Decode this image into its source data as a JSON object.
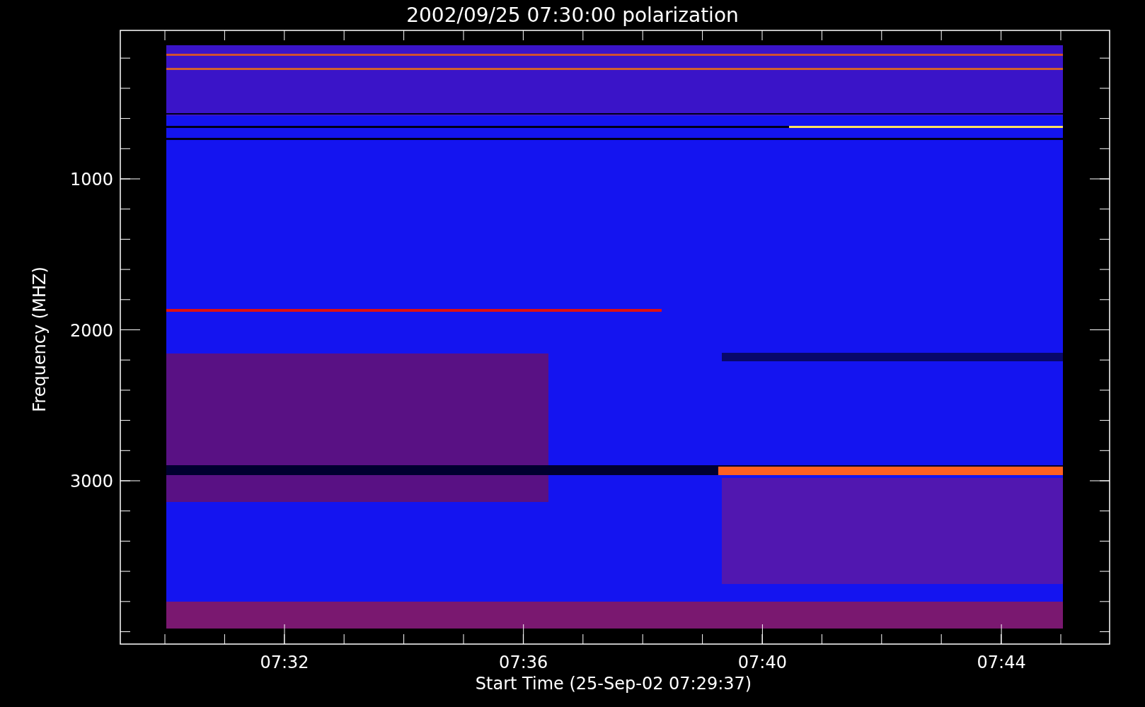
{
  "title": "2002/09/25 07:30:00 polarization",
  "y_axis": {
    "label": "Frequency (MHZ)",
    "ticks": [
      "1000",
      "2000",
      "3000"
    ]
  },
  "x_axis": {
    "label": "Start Time (25-Sep-02 07:29:37)",
    "ticks": [
      "07:32",
      "07:36",
      "07:40",
      "07:44"
    ]
  }
}
